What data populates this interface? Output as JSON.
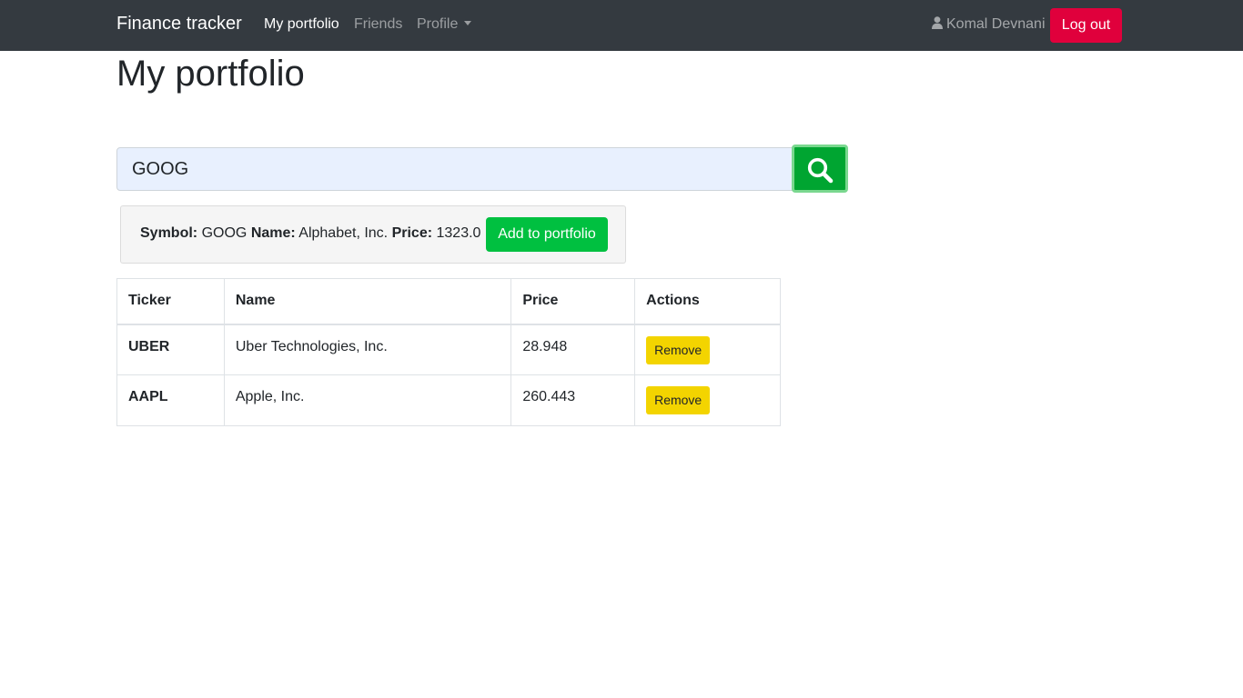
{
  "navbar": {
    "brand": "Finance tracker",
    "links": [
      {
        "label": "My portfolio",
        "active": true
      },
      {
        "label": "Friends",
        "active": false
      },
      {
        "label": "Profile",
        "active": false
      }
    ],
    "user_icon": "user-icon",
    "user_name": "Komal Devnani",
    "logout_label": "Log out"
  },
  "page": {
    "title": "My portfolio"
  },
  "search": {
    "value": "GOOG",
    "button_icon": "search-icon"
  },
  "result": {
    "symbol_label": "Symbol:",
    "symbol": "GOOG",
    "name_label": "Name:",
    "name": "Alphabet, Inc.",
    "price_label": "Price:",
    "price": "1323.0",
    "add_label": "Add to portfolio"
  },
  "table": {
    "headers": [
      "Ticker",
      "Name",
      "Price",
      "Actions"
    ],
    "rows": [
      {
        "ticker": "UBER",
        "name": "Uber Technologies, Inc.",
        "price": "28.948",
        "action": "Remove"
      },
      {
        "ticker": "AAPL",
        "name": "Apple, Inc.",
        "price": "260.443",
        "action": "Remove"
      }
    ]
  },
  "colors": {
    "navbar": "#343a40",
    "logout": "#e0003c",
    "search_button": "#00a531",
    "add_button": "#00c040",
    "remove_button": "#f3d400"
  }
}
